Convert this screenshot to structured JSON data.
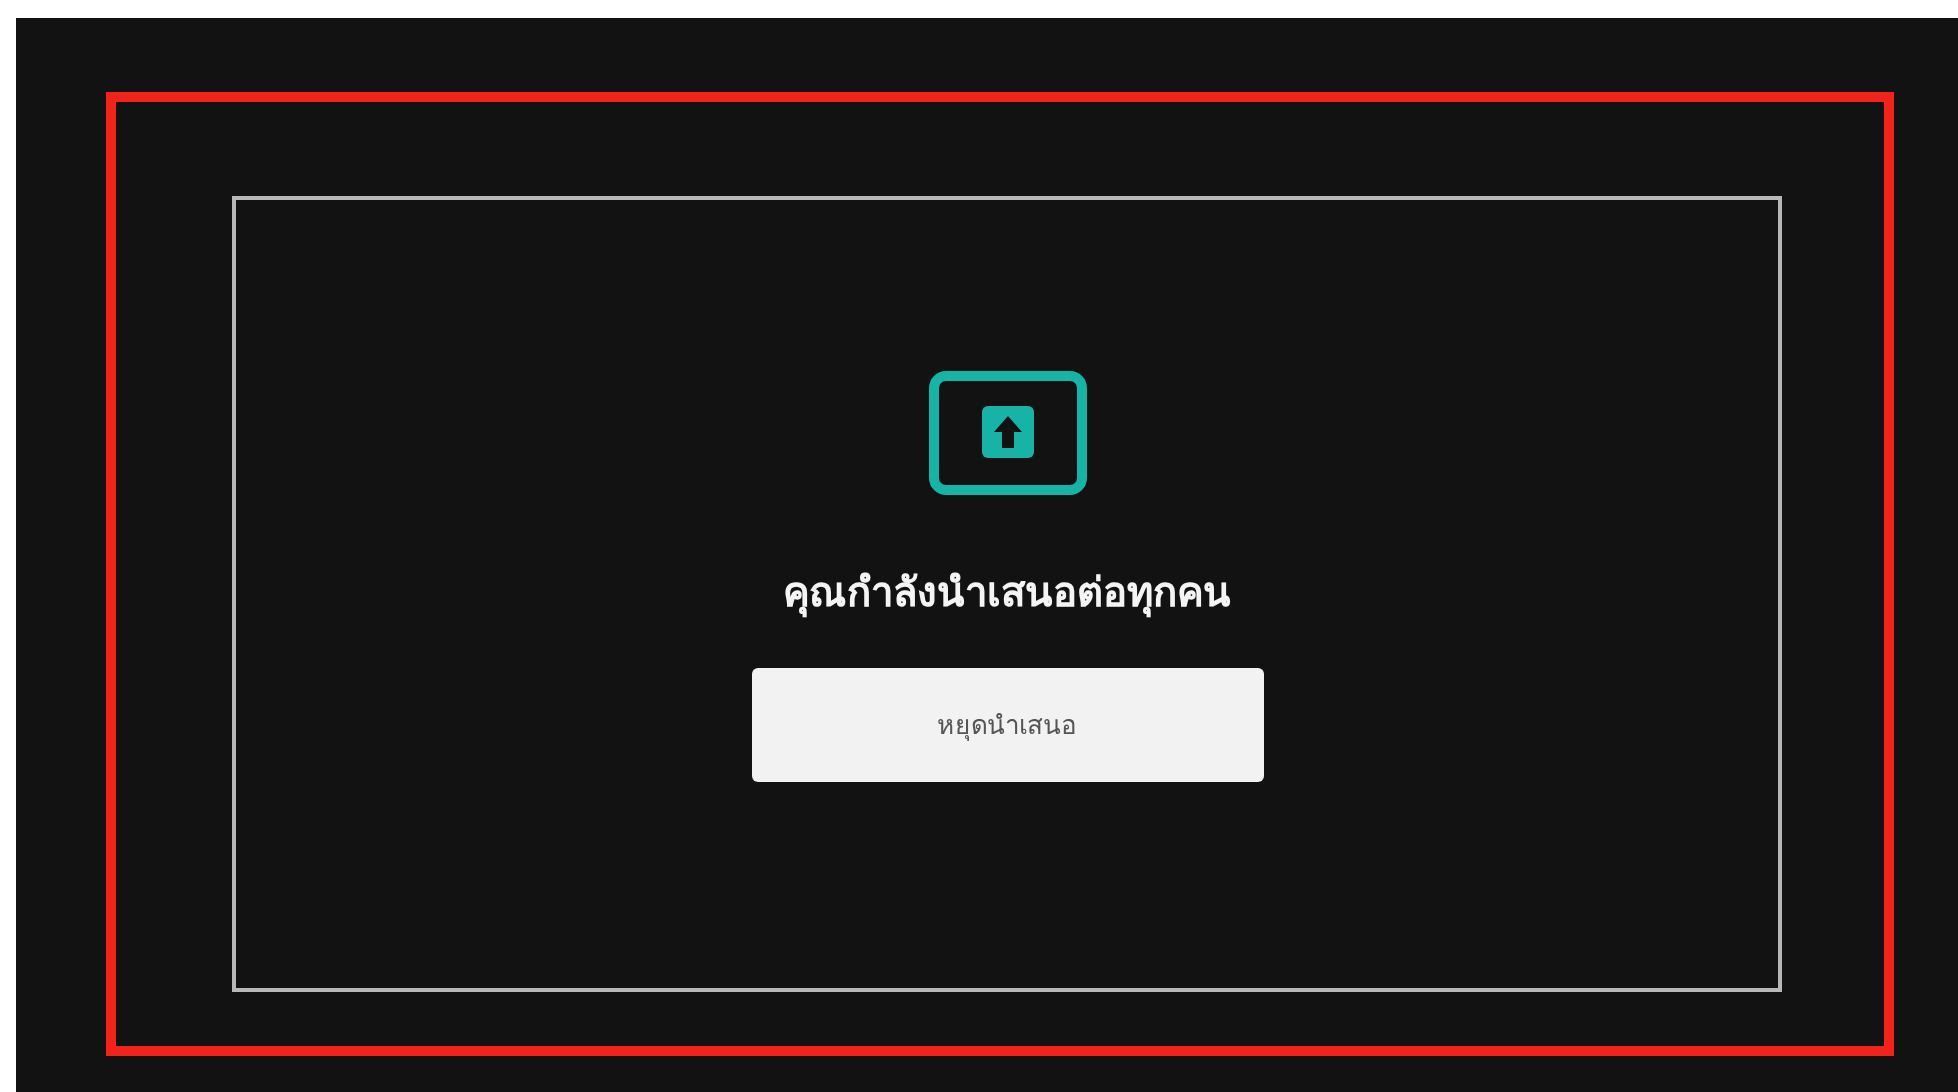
{
  "presenting": {
    "message": "คุณกำลังนำเสนอต่อทุกคน",
    "stop_button": "หยุดนำเสนอ"
  }
}
